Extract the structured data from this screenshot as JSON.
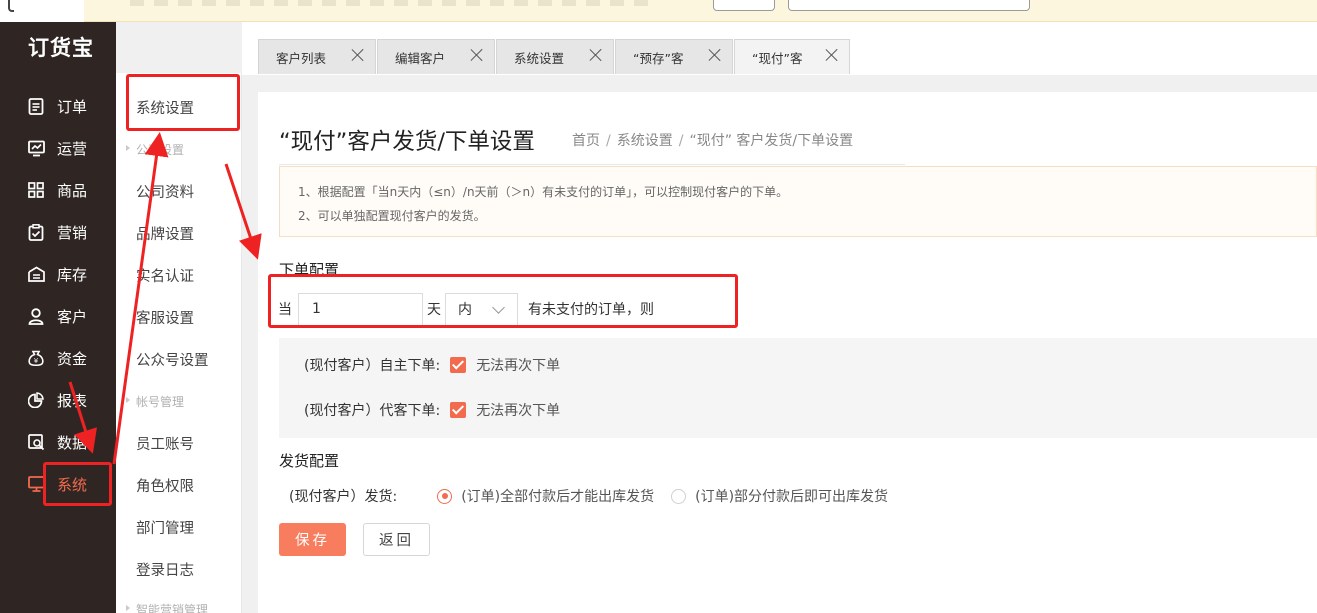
{
  "app": {
    "logo": "订货宝"
  },
  "nav": {
    "items": [
      {
        "label": "订单",
        "icon": "order-doc-icon"
      },
      {
        "label": "运营",
        "icon": "chart-board-icon"
      },
      {
        "label": "商品",
        "icon": "grid-icon"
      },
      {
        "label": "营销",
        "icon": "clipboard-check-icon"
      },
      {
        "label": "库存",
        "icon": "warehouse-icon"
      },
      {
        "label": "客户",
        "icon": "person-icon"
      },
      {
        "label": "资金",
        "icon": "money-bag-icon"
      },
      {
        "label": "报表",
        "icon": "pie-icon"
      },
      {
        "label": "数据",
        "icon": "magnify-data-icon"
      },
      {
        "label": "系统",
        "icon": "monitor-icon"
      }
    ],
    "active": "系统"
  },
  "submenu": {
    "title": "系统设置",
    "group_company": "公司设置",
    "company_info": "公司资料",
    "brand": "品牌设置",
    "realname": "实名认证",
    "service": "客服设置",
    "wechat": "公众号设置",
    "group_account": "帐号管理",
    "staff": "员工账号",
    "roles": "角色权限",
    "dept": "部门管理",
    "log": "登录日志",
    "group_marketing": "智能营销管理"
  },
  "tabs": [
    {
      "label": "客户列表"
    },
    {
      "label": "编辑客户"
    },
    {
      "label": "系统设置"
    },
    {
      "label": "“预存”客"
    },
    {
      "label": "“现付”客"
    }
  ],
  "page": {
    "title": "“现付”客户发货/下单设置",
    "breadcrumb": [
      "首页",
      "系统设置",
      "“现付” 客户发货/下单设置"
    ],
    "breadcrumb_sep": "/",
    "notice_1": "1、根据配置「当n天内（≤n）/n天前（＞n）有未支付的订单」，可以控制现付客户的下单。",
    "notice_2": "2、可以单独配置现付客户的发货。"
  },
  "order_config": {
    "heading": "下单配置",
    "prefix": "当",
    "days_value": "1",
    "days_unit": "天",
    "range_selected": "内",
    "suffix": "有未支付的订单，则",
    "self_order_label": "(现付客户）自主下单:",
    "self_order_option": "无法再次下单",
    "self_order_checked": true,
    "proxy_order_label": "(现付客户）代客下单:",
    "proxy_order_option": "无法再次下单",
    "proxy_order_checked": true
  },
  "ship_config": {
    "heading": "发货配置",
    "label": "(现付客户）发货:",
    "option_full": "(订单)全部付款后才能出库发货",
    "option_partial": "(订单)部分付款后即可出库发货",
    "selected": "full"
  },
  "buttons": {
    "save": "保存",
    "back": "返回"
  },
  "colors": {
    "accent": "#f26b4e",
    "sidebar": "#2f2624",
    "annotation": "#ee2222"
  }
}
